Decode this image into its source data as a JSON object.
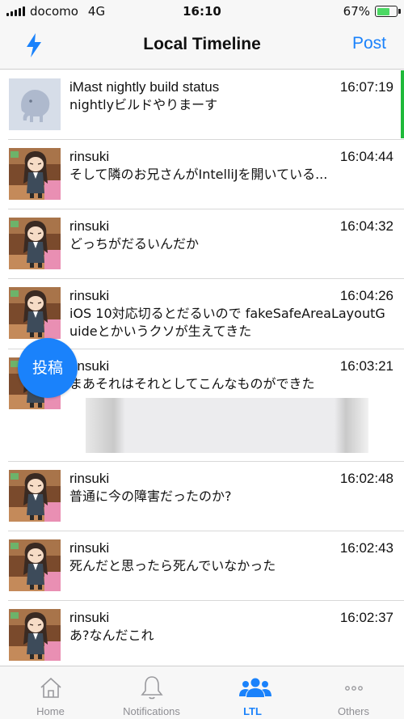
{
  "status_bar": {
    "carrier": "docomo",
    "network": "4G",
    "time": "16:10",
    "battery_percent": "67%",
    "battery_level": 0.67
  },
  "nav": {
    "left_icon": "bolt-icon",
    "title": "Local Timeline",
    "post_label": "Post"
  },
  "timeline": {
    "posts": [
      {
        "user": "iMast nightly build status",
        "time": "16:07:19",
        "body": "nightlyビルドやりまーす",
        "avatar": "elephant-default-avatar",
        "accent": "#1fba3a"
      },
      {
        "user": "rinsuki",
        "time": "16:04:44",
        "body": "そして隣のお兄さんがIntelliJを開いている...",
        "avatar": "anime-girl-avatar"
      },
      {
        "user": "rinsuki",
        "time": "16:04:32",
        "body": "どっちがだるいんだか",
        "avatar": "anime-girl-avatar"
      },
      {
        "user": "rinsuki",
        "time": "16:04:26",
        "body": "iOS 10対応切るとだるいので fakeSafeAreaLayoutGuideとかいうクソが生えてきた",
        "avatar": "anime-girl-avatar"
      },
      {
        "user": "rinsuki",
        "time": "16:03:21",
        "body": "まあそれはそれとしてこんなものができた",
        "avatar": "anime-girl-avatar",
        "has_attachment": true
      },
      {
        "user": "rinsuki",
        "time": "16:02:48",
        "body": "普通に今の障害だったのか?",
        "avatar": "anime-girl-avatar"
      },
      {
        "user": "rinsuki",
        "time": "16:02:43",
        "body": "死んだと思ったら死んでいなかった",
        "avatar": "anime-girl-avatar"
      },
      {
        "user": "rinsuki",
        "time": "16:02:37",
        "body": "あ?なんだこれ",
        "avatar": "anime-girl-avatar"
      }
    ]
  },
  "fab": {
    "label": "投稿"
  },
  "tabs": [
    {
      "label": "Home",
      "icon": "home-icon",
      "active": false
    },
    {
      "label": "Notifications",
      "icon": "bell-icon",
      "active": false
    },
    {
      "label": "LTL",
      "icon": "users-icon",
      "active": true
    },
    {
      "label": "Others",
      "icon": "more-icon",
      "active": false
    }
  ],
  "colors": {
    "accent": "#1a82fb",
    "bar_background": "#f7f7f7",
    "inactive_tab": "#8e8e93",
    "build_status_accent": "#1fba3a"
  }
}
